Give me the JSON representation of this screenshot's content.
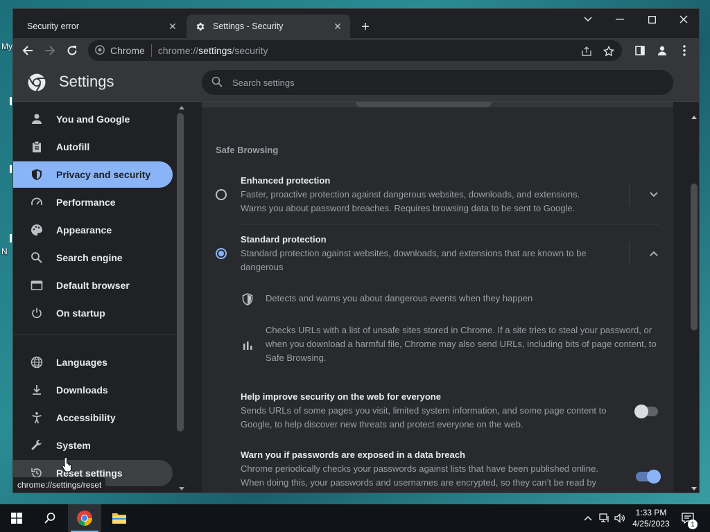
{
  "desktop": {
    "label_1": "My",
    "label_2": "N"
  },
  "window": {
    "tabs": [
      {
        "title": "Security error",
        "active": false
      },
      {
        "title": "Settings - Security",
        "active": true
      }
    ]
  },
  "toolbar": {
    "omnibox_chrome": "Chrome",
    "url_scheme": "chrome://",
    "url_host": "settings",
    "url_path": "/security"
  },
  "settings": {
    "title": "Settings",
    "search_placeholder": "Search settings"
  },
  "sidebar": {
    "items": [
      {
        "label": "You and Google",
        "icon": "person-icon"
      },
      {
        "label": "Autofill",
        "icon": "clipboard-icon"
      },
      {
        "label": "Privacy and security",
        "icon": "shield-icon",
        "selected": true
      },
      {
        "label": "Performance",
        "icon": "speedometer-icon"
      },
      {
        "label": "Appearance",
        "icon": "palette-icon"
      },
      {
        "label": "Search engine",
        "icon": "search-icon"
      },
      {
        "label": "Default browser",
        "icon": "browser-icon"
      },
      {
        "label": "On startup",
        "icon": "power-icon"
      },
      {
        "label": "Languages",
        "icon": "globe-icon"
      },
      {
        "label": "Downloads",
        "icon": "download-icon"
      },
      {
        "label": "Accessibility",
        "icon": "accessibility-icon"
      },
      {
        "label": "System",
        "icon": "wrench-icon"
      },
      {
        "label": "Reset settings",
        "icon": "reset-icon",
        "hover": true
      }
    ]
  },
  "status_tip": "chrome://settings/reset",
  "main": {
    "section_title": "Safe Browsing",
    "enhanced": {
      "title": "Enhanced protection",
      "desc": "Faster, proactive protection against dangerous websites, downloads, and extensions. Warns you about password breaches. Requires browsing data to be sent to Google.",
      "checked": false
    },
    "standard": {
      "title": "Standard protection",
      "desc": "Standard protection against websites, downloads, and extensions that are known to be dangerous",
      "checked": true
    },
    "details": [
      "Detects and warns you about dangerous events when they happen",
      "Checks URLs with a list of unsafe sites stored in Chrome. If a site tries to steal your password, or when you download a harmful file, Chrome may also send URLs, including bits of page content, to Safe Browsing."
    ],
    "help_improve": {
      "title": "Help improve security on the web for everyone",
      "desc": "Sends URLs of some pages you visit, limited system information, and some page content to Google, to help discover new threats and protect everyone on the web.",
      "enabled": false
    },
    "password_warn": {
      "title": "Warn you if passwords are exposed in a data breach",
      "desc": "Chrome periodically checks your passwords against lists that have been published online. When doing this, your passwords and usernames are encrypted, so they can’t be read by anyone, including Google.",
      "enabled": true
    }
  },
  "taskbar": {
    "time": "1:33 PM",
    "date": "4/25/2023",
    "notification_count": "1"
  }
}
